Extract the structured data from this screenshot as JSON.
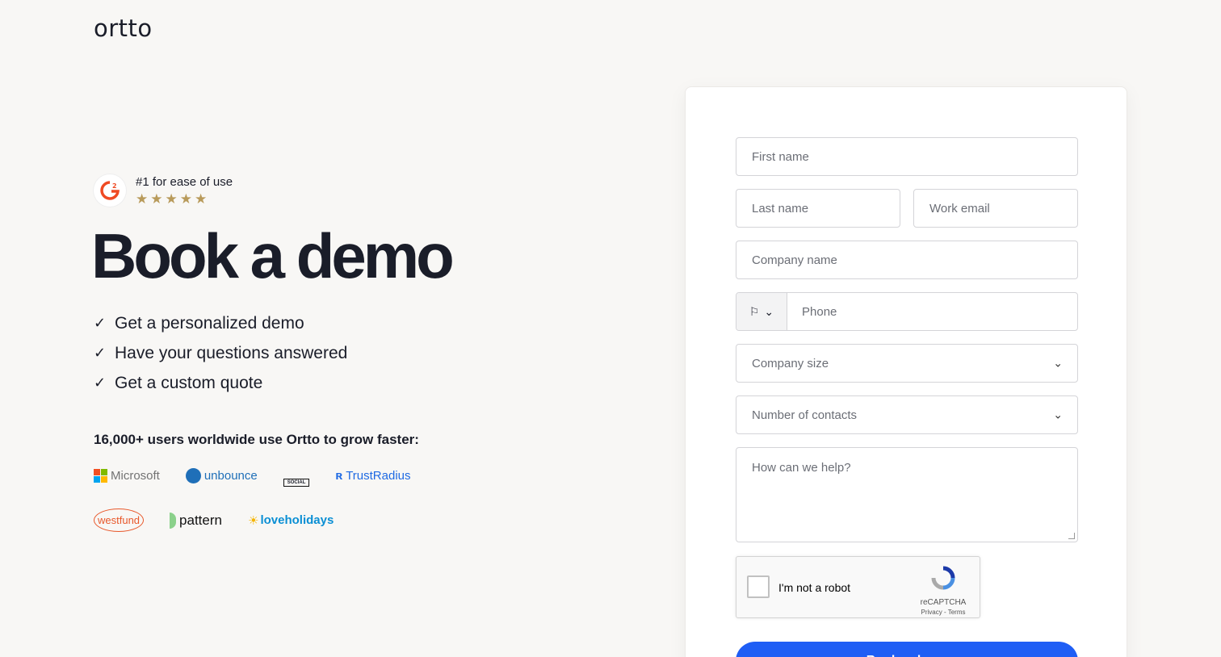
{
  "brand": {
    "logo": "ortto"
  },
  "badge": {
    "title": "#1 for ease of use",
    "rating": 5
  },
  "headline": "Book a demo",
  "benefits": [
    "Get a personalized demo",
    "Have your questions answered",
    "Get a custom quote"
  ],
  "social": {
    "title": "16,000+ users worldwide use Ortto to grow faster:",
    "logos": [
      "Microsoft",
      "unbounce",
      "SOCIAL",
      "TrustRadius",
      "westfund",
      "pattern",
      "loveholidays"
    ]
  },
  "form": {
    "first_name": "First name",
    "last_name": "Last name",
    "work_email": "Work email",
    "company_name": "Company name",
    "phone": "Phone",
    "company_size": "Company size",
    "contacts": "Number of contacts",
    "help": "How can we help?",
    "recaptcha_label": "I'm not a robot",
    "recaptcha_brand": "reCAPTCHA",
    "recaptcha_links": "Privacy - Terms",
    "submit": "Book a demo"
  },
  "colors": {
    "accent": "#1f5ef5",
    "star": "#b89a5a",
    "background": "#f8f7f5"
  }
}
